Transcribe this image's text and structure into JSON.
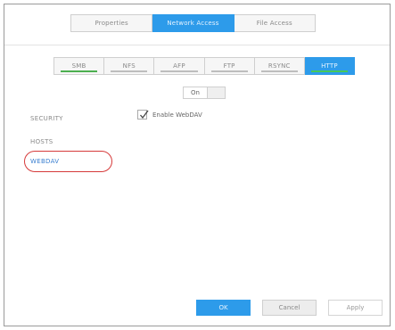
{
  "top_tabs": {
    "properties": "Properties",
    "network_access": "Network Access",
    "file_access": "File Access"
  },
  "protocols": [
    "SMB",
    "NFS",
    "AFP",
    "FTP",
    "RSYNC",
    "HTTP"
  ],
  "toggle": {
    "state": "On"
  },
  "webdav": {
    "label": "Enable WebDAV",
    "checked": true
  },
  "sidebar": {
    "security": "SECURITY",
    "hosts": "HOSTS",
    "webdav": "WEBDAV"
  },
  "buttons": {
    "ok": "OK",
    "cancel": "Cancel",
    "apply": "Apply"
  },
  "colors": {
    "accent": "#2d9bea",
    "status_green": "#4caf50",
    "highlight": "#d63a3a"
  }
}
